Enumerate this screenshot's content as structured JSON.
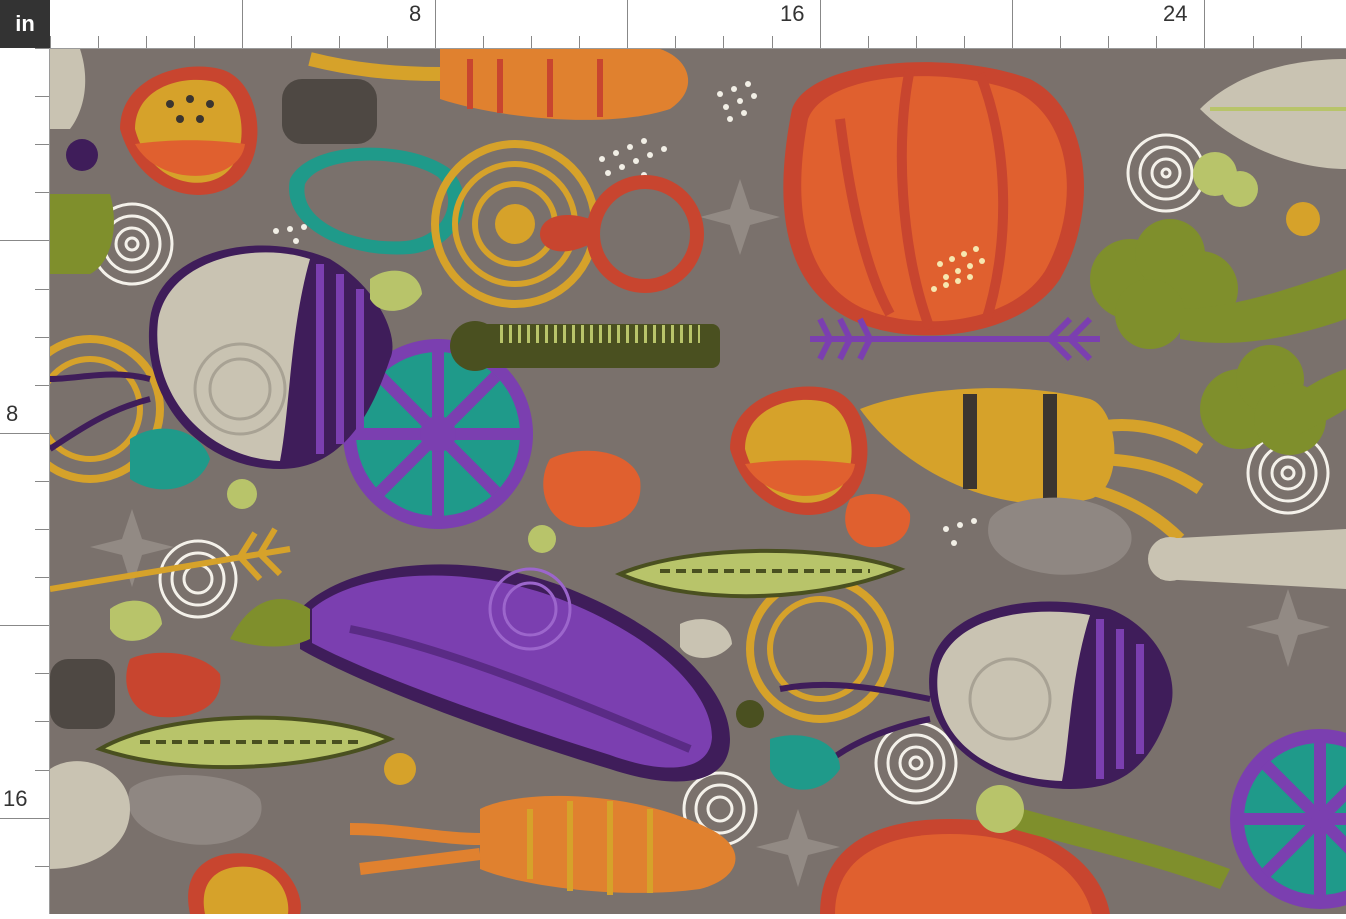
{
  "ruler": {
    "unit": "in",
    "top_labels": [
      "8",
      "16",
      "24"
    ],
    "left_labels": [
      "8",
      "16"
    ]
  },
  "fabric": {
    "pattern": "vegetables",
    "background_color": "#7a716c",
    "palette": {
      "orange": "#e0602f",
      "red": "#c8452f",
      "mustard": "#d6a22a",
      "purple": "#7b3fb0",
      "dark_purple": "#3f1d5a",
      "olive": "#7f8f2c",
      "lime": "#b8c46a",
      "teal": "#1f9a8a",
      "beige": "#c9c3b2",
      "white": "#ffffff",
      "dark": "#3b3530"
    },
    "motifs": [
      "pumpkin",
      "eggplant",
      "carrot",
      "beet",
      "pomegranate",
      "broccoli",
      "onion",
      "pea-pod",
      "potato",
      "lemon-slice",
      "star",
      "leaf"
    ]
  }
}
